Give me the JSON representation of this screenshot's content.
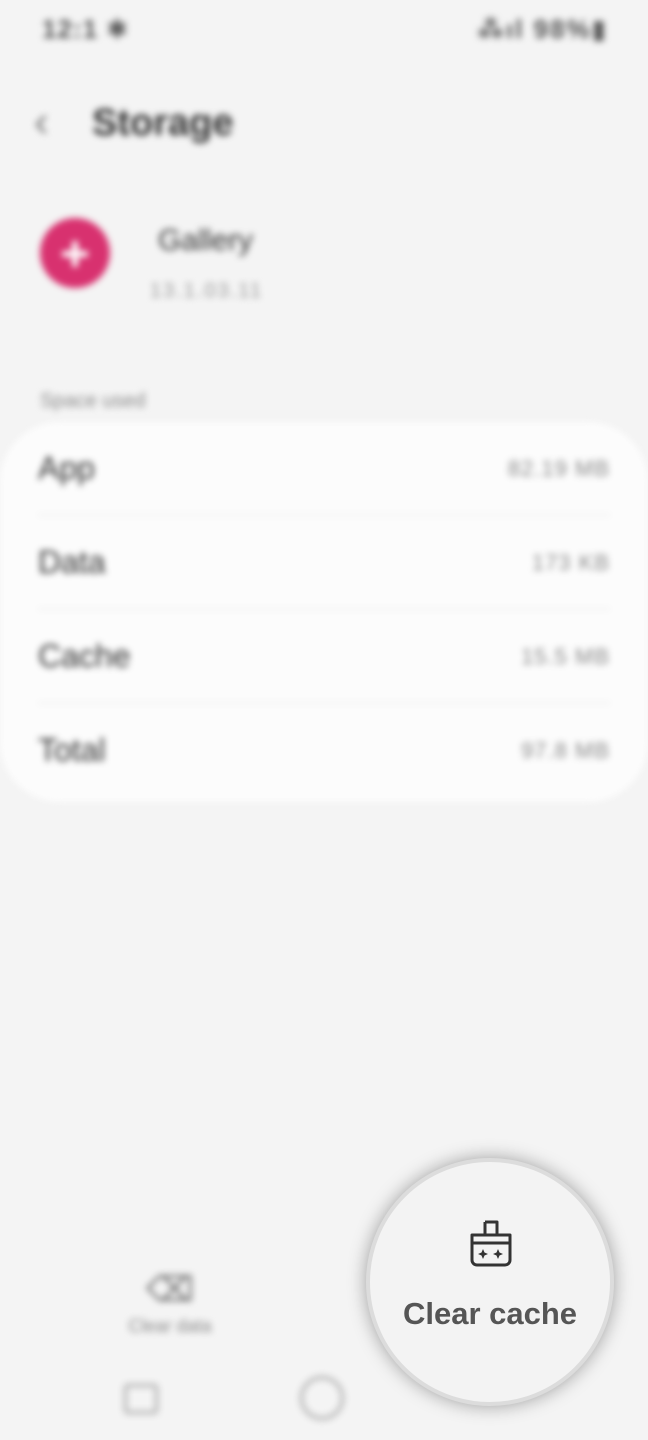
{
  "status_bar": {
    "time": "12:1 ✱",
    "icons": "⁂ıl 98%▮"
  },
  "header": {
    "back_icon": "back-arrow-icon",
    "title": "Storage"
  },
  "app": {
    "icon": "gallery-app-icon",
    "name": "Gallery",
    "version": "13.1.03.11"
  },
  "section": {
    "label": "Space used"
  },
  "storage_rows": [
    {
      "label": "App",
      "value": "82.19 MB"
    },
    {
      "label": "Data",
      "value": "173 KB"
    },
    {
      "label": "Cache",
      "value": "15.5 MB"
    },
    {
      "label": "Total",
      "value": "97.8 MB"
    }
  ],
  "bottom_actions": {
    "clear_data_label": "Clear data",
    "clear_data_icon": "clear-data-icon"
  },
  "nav": {
    "recents_icon": "recents-icon",
    "home_icon": "home-icon"
  },
  "magnifier": {
    "label": "Clear cache",
    "icon": "brush-icon"
  },
  "colors": {
    "app_icon": "#d8316f",
    "background": "#f4f4f4",
    "card": "#fcfcfc"
  }
}
